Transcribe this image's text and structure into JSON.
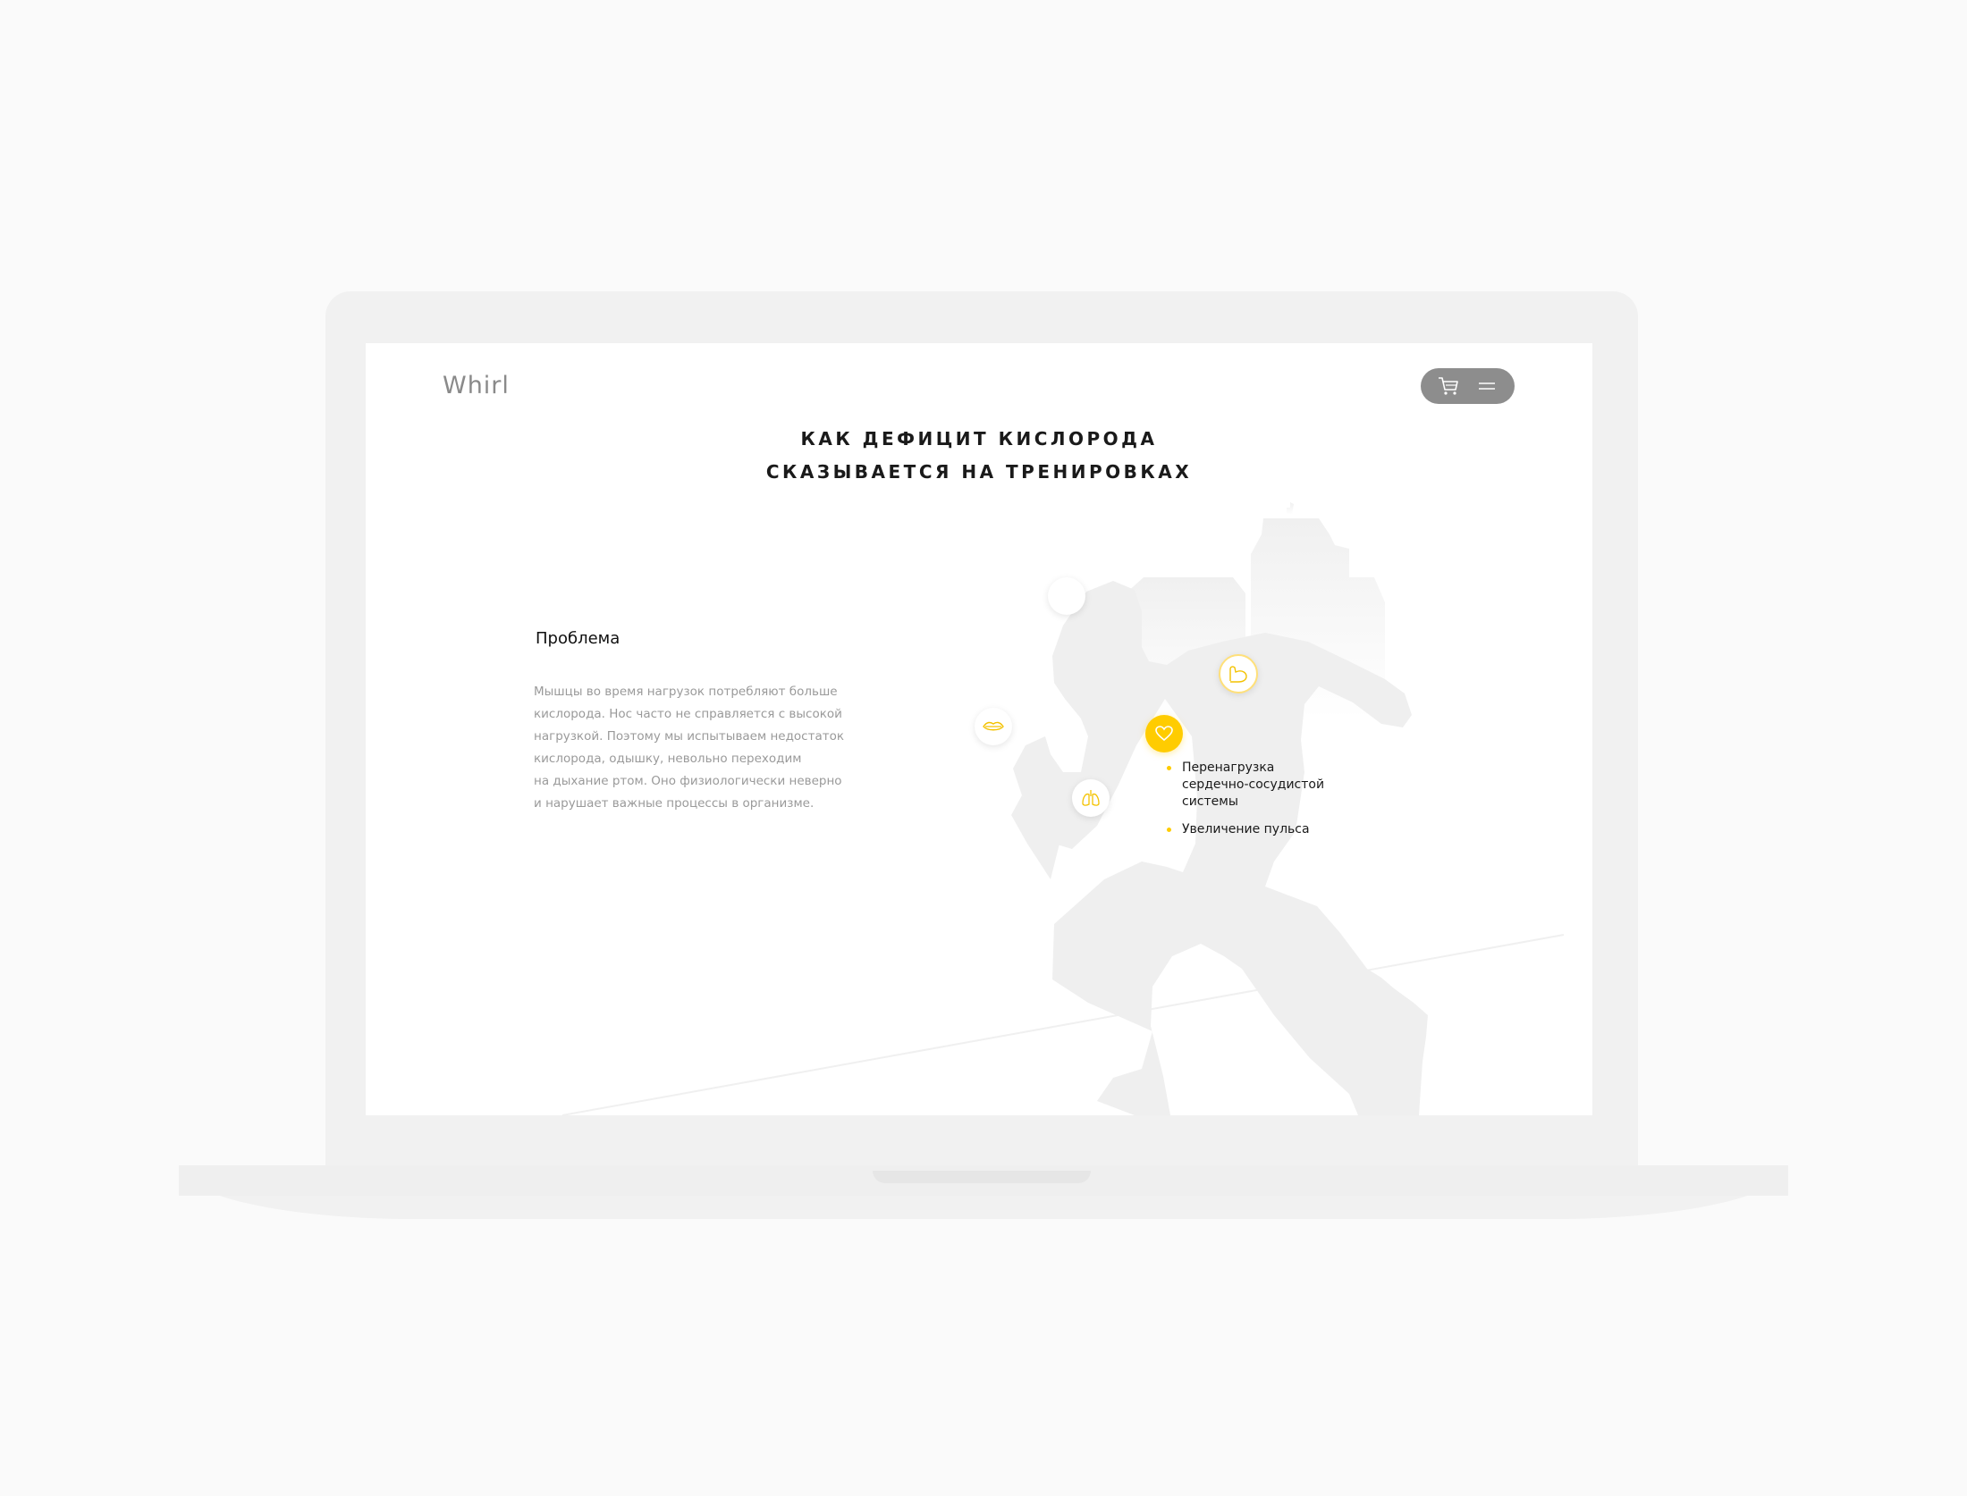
{
  "site": {
    "logo_text": "Whirl",
    "title_lines": [
      "КАК ДЕФИЦИТ КИСЛОРОДА",
      "СКАЗЫВАЕТСЯ НА ТРЕНИРОВКАХ"
    ]
  },
  "nav": {
    "cart_icon": "cart-icon",
    "menu_icon": "menu-icon"
  },
  "problem": {
    "heading": "Проблема",
    "lines": [
      "Мышцы во время нагрузок потребляют больше",
      "кислорода. Нос часто не справляется с высокой",
      "нагрузкой. Поэтому мы испытываем недостаток",
      "кислорода, одышку, невольно переходим",
      "на дыхание ртом. Оно физиологически неверно",
      "и нарушает важные процессы в организме."
    ]
  },
  "markers": {
    "head": "head-marker",
    "mouth": "lips-icon",
    "lungs": "lungs-icon",
    "heart": "heart-icon",
    "muscle": "bicep-icon"
  },
  "effects": {
    "items": [
      {
        "lines": [
          "Перенагрузка",
          "сердечно-сосудистой",
          "системы"
        ]
      },
      {
        "lines": [
          "Увеличение пульса"
        ]
      }
    ]
  },
  "colors": {
    "accent": "#ffcc00",
    "silhouette": "#efefef",
    "background": "#fafafa"
  }
}
